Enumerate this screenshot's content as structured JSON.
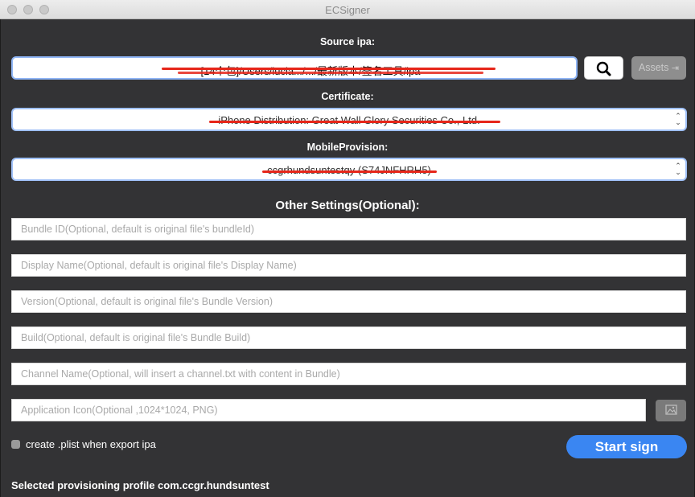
{
  "window": {
    "title": "ECSigner"
  },
  "source": {
    "label": "Source ipa:",
    "value": "[14个包]/Users/lucia.../.../最新版本/签名工具/ipa",
    "search_icon": "magnifier-icon",
    "assets_label": "Assets",
    "assets_icon": "export-icon"
  },
  "certificate": {
    "label": "Certificate:",
    "value": "iPhone Distribution: Great Wall Glory Securities Co., Ltd."
  },
  "provision": {
    "label": "MobileProvision:",
    "value": "ccgrhundsuntestqy (S74JNFHRH5)"
  },
  "other": {
    "heading": "Other Settings(Optional):",
    "bundle_id_placeholder": "Bundle ID(Optional, default is original file's bundleId)",
    "display_name_placeholder": "Display Name(Optional, default is original file's Display Name)",
    "version_placeholder": "Version(Optional, default is original file's Bundle Version)",
    "build_placeholder": "Build(Optional, default is original file's Bundle Build)",
    "channel_placeholder": "Channel Name(Optional, will insert a channel.txt with content in Bundle)",
    "app_icon_placeholder": "Application Icon(Optional ,1024*1024, PNG)",
    "image_icon": "image-icon"
  },
  "plist": {
    "label": "create .plist when export ipa",
    "checked": false
  },
  "start_label": "Start sign",
  "status": "Selected provisioning profile com.ccgr.hundsuntest",
  "colors": {
    "accent": "#3a86f2",
    "redaction": "#e6261a",
    "background": "#333335"
  }
}
